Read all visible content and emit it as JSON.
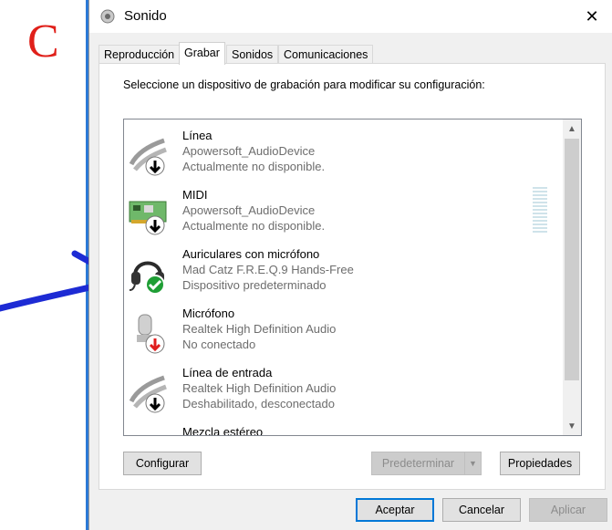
{
  "annotation": {
    "letter": "C",
    "arrow_color": "#1d2bd4",
    "letter_color": "#e0201a"
  },
  "window": {
    "title": "Sonido",
    "close_glyph": "✕"
  },
  "tabs": [
    {
      "label": "Reproducción",
      "active": false
    },
    {
      "label": "Grabar",
      "active": true
    },
    {
      "label": "Sonidos",
      "active": false
    },
    {
      "label": "Comunicaciones",
      "active": false
    }
  ],
  "instruction": "Seleccione un dispositivo de grabación para modificar su configuración:",
  "devices": [
    {
      "name": "Línea",
      "driver": "Apowersoft_AudioDevice",
      "status": "Actualmente no disponible.",
      "icon": "line-in-cable-icon",
      "badge": "down-arrow-black"
    },
    {
      "name": "MIDI",
      "driver": "Apowersoft_AudioDevice",
      "status": "Actualmente no disponible.",
      "icon": "midi-card-icon",
      "badge": "down-arrow-black"
    },
    {
      "name": "Auriculares con micrófono",
      "driver": "Mad Catz F.R.E.Q.9 Hands-Free",
      "status": "Dispositivo predeterminado",
      "icon": "headset-icon",
      "badge": "checkmark-green"
    },
    {
      "name": "Micrófono",
      "driver": "Realtek High Definition Audio",
      "status": "No conectado",
      "icon": "microphone-icon",
      "badge": "down-arrow-red"
    },
    {
      "name": "Línea de entrada",
      "driver": "Realtek High Definition Audio",
      "status": "Deshabilitado, desconectado",
      "icon": "line-in-cable-icon",
      "badge": "down-arrow-black"
    },
    {
      "name": "Mezcla estéreo",
      "driver": "",
      "status": "",
      "icon": "line-in-cable-icon",
      "badge": ""
    }
  ],
  "buttons": {
    "configurar": "Configurar",
    "predeterminar": "Predeterminar",
    "propiedades": "Propiedades",
    "aceptar": "Aceptar",
    "cancelar": "Cancelar",
    "aplicar": "Aplicar"
  },
  "colors": {
    "accent": "#0078d7",
    "window_bg": "#f0f0f0",
    "badge_green": "#1f9e35",
    "badge_red": "#e01d1d"
  }
}
